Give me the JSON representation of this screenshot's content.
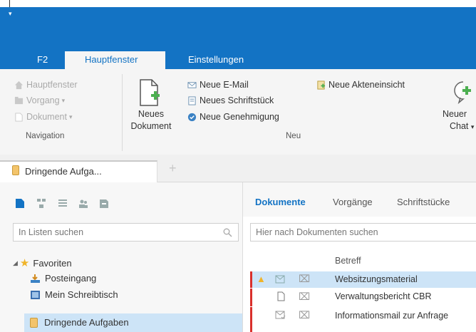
{
  "ribbon_tabs": {
    "f2": "F2",
    "hauptfenster": "Hauptfenster",
    "einstellungen": "Einstellungen"
  },
  "navigation": {
    "hauptfenster": "Hauptfenster",
    "vorgang": "Vorgang",
    "dokument": "Dokument",
    "group_label": "Navigation"
  },
  "neu": {
    "neues_dokument_line1": "Neues",
    "neues_dokument_line2": "Dokument",
    "neue_email": "Neue E-Mail",
    "neues_schriftstueck": "Neues Schriftstück",
    "neue_genehmigung": "Neue Genehmigung",
    "neue_akteneinsicht": "Neue Akteneinsicht",
    "neuer_chat_line1": "Neuer",
    "neuer_chat_line2": "Chat",
    "group_label": "Neu"
  },
  "doc_tab": {
    "label": "Dringende Aufga...",
    "add": "+"
  },
  "left": {
    "search_placeholder": "In Listen suchen",
    "tree": {
      "favoriten": "Favoriten",
      "posteingang": "Posteingang",
      "mein_schreibtisch": "Mein Schreibtisch",
      "dringende_aufgaben": "Dringende Aufgaben"
    }
  },
  "right": {
    "tabs": [
      "Dokumente",
      "Vorgänge",
      "Schriftstücke"
    ],
    "search_placeholder": "Hier nach Dokumenten suchen",
    "column_betreff": "Betreff",
    "rows": [
      {
        "betreff": "Websitzungsmaterial"
      },
      {
        "betreff": "Verwaltungsbericht CBR"
      },
      {
        "betreff": "Informationsmail zur Anfrage"
      }
    ]
  },
  "colors": {
    "accent": "#1373c4",
    "selection": "#cde4f7",
    "flag": "#d9302c"
  }
}
